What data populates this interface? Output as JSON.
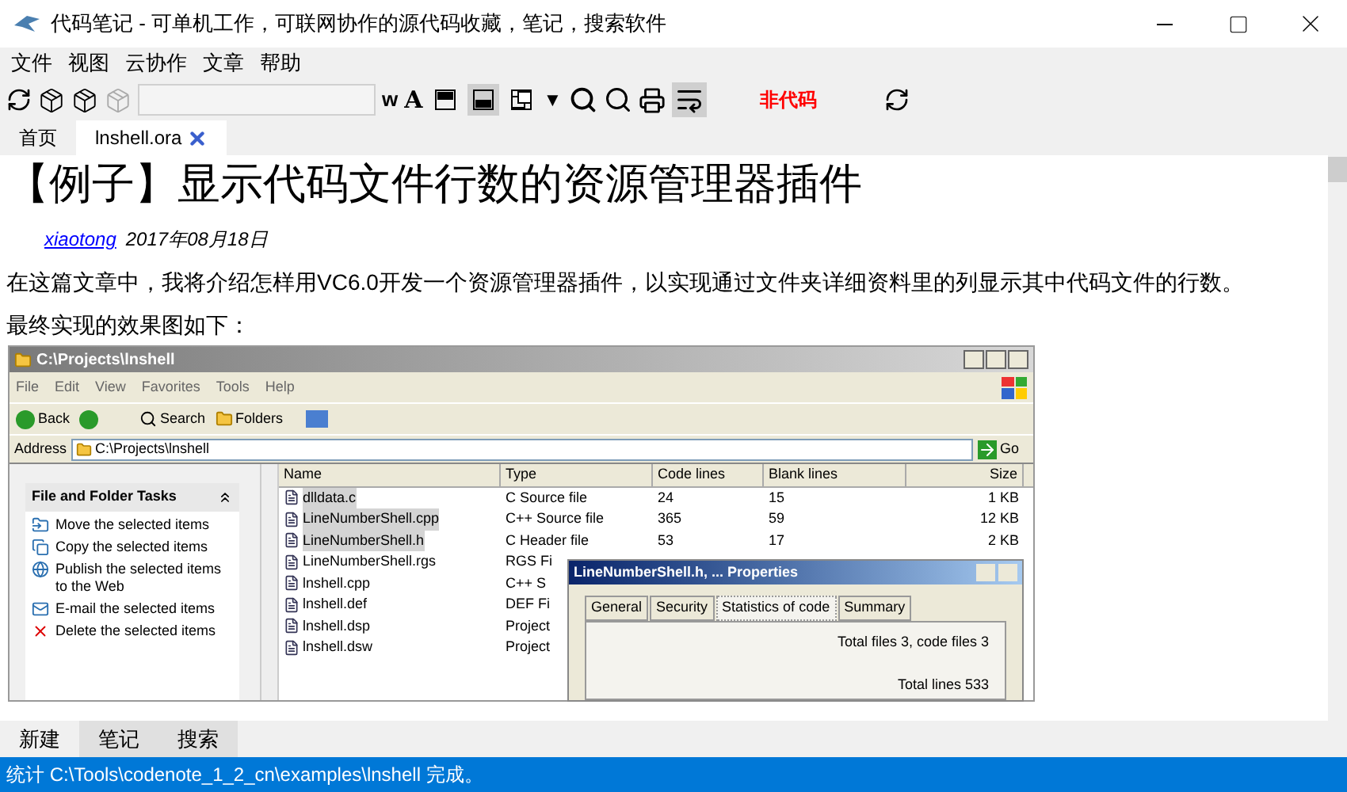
{
  "window": {
    "title": "代码笔记 - 可单机工作，可联网协作的源代码收藏，笔记，搜索软件"
  },
  "menu": [
    "文件",
    "视图",
    "云协作",
    "文章",
    "帮助"
  ],
  "toolbar": {
    "glyphs": [
      "w",
      "A"
    ],
    "dropdown": "▼",
    "toggles": [
      {
        "kind": "pane-top",
        "pressed": false
      },
      {
        "kind": "pane-bottom",
        "pressed": true
      },
      {
        "kind": "windows",
        "pressed": false
      }
    ],
    "wrap_pressed": true,
    "filter_label": "非代码"
  },
  "tabs": [
    {
      "label": "首页",
      "selected": false,
      "closable": false
    },
    {
      "label": "lnshell.ora",
      "selected": true,
      "closable": true
    }
  ],
  "article": {
    "title": "【例子】显示代码文件行数的资源管理器插件",
    "author": "xiaotong",
    "date": "2017年08月18日",
    "paragraphs": [
      "在这篇文章中，我将介绍怎样用VC6.0开发一个资源管理器插件，以实现通过文件夹详细资料里的列显示其中代码文件的行数。",
      "最终实现的效果图如下："
    ]
  },
  "explorer": {
    "title": "C:\\Projects\\lnshell",
    "menu": [
      "File",
      "Edit",
      "View",
      "Favorites",
      "Tools",
      "Help"
    ],
    "toolbar": [
      "Back",
      "Search",
      "Folders"
    ],
    "address_label": "Address",
    "address": "C:\\Projects\\lnshell",
    "go": "Go",
    "tasks_title": "File and Folder Tasks",
    "tasks": [
      "Move the selected items",
      "Copy the selected items",
      "Publish the selected items to the Web",
      "E-mail the selected items",
      "Delete the selected items"
    ],
    "columns": [
      "Name",
      "Type",
      "Code lines",
      "Blank lines",
      "Size"
    ],
    "rows": [
      {
        "name": "dlldata.c",
        "type": "C Source file",
        "code": "24",
        "blank": "15",
        "size": "1 KB",
        "selected": true
      },
      {
        "name": "LineNumberShell.cpp",
        "type": "C++ Source file",
        "code": "365",
        "blank": "59",
        "size": "12 KB",
        "selected": true
      },
      {
        "name": "LineNumberShell.h",
        "type": "C Header file",
        "code": "53",
        "blank": "17",
        "size": "2 KB",
        "selected": true
      },
      {
        "name": "LineNumberShell.rgs",
        "type": "RGS Fi",
        "selected": false
      },
      {
        "name": "lnshell.cpp",
        "type": "C++ S",
        "selected": false
      },
      {
        "name": "lnshell.def",
        "type": "DEF Fi",
        "selected": false
      },
      {
        "name": "lnshell.dsp",
        "type": "Project",
        "selected": false
      },
      {
        "name": "lnshell.dsw",
        "type": "Project",
        "selected": false
      }
    ],
    "dialog": {
      "title": "LineNumberShell.h, ... Properties",
      "tabs": [
        {
          "label": "General",
          "selected": false
        },
        {
          "label": "Security",
          "selected": false
        },
        {
          "label": "Statistics of code",
          "selected": true
        },
        {
          "label": "Summary",
          "selected": false
        }
      ],
      "lines": [
        "Total files 3, code files 3",
        "Total lines 533"
      ]
    }
  },
  "bottom_tabs": [
    {
      "label": "新建",
      "selected": true
    },
    {
      "label": "笔记",
      "selected": false
    },
    {
      "label": "搜索",
      "selected": false
    }
  ],
  "status_bar": "统计 C:\\Tools\\codenote_1_2_cn\\examples\\lnshell 完成。"
}
